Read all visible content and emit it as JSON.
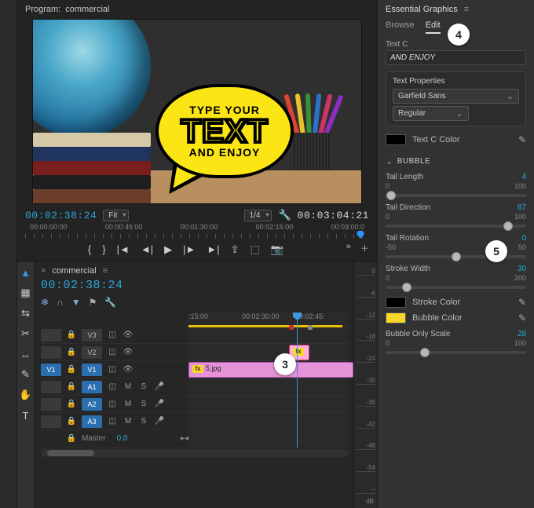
{
  "program": {
    "label": "Program:",
    "sequence_name": "commercial",
    "bubble_text": {
      "line1": "TYPE YOUR",
      "line2": "TEXT",
      "line3": "AND ENJOY"
    },
    "current_tc": "00:02:38:24",
    "fit_label": "Fit",
    "scale_label": "1/4",
    "duration_tc": "00:03:04:21",
    "ruler_labels": [
      "00:00:00:00",
      "00:00:45:00",
      "00:01:30:00",
      "00:02:15:00",
      "00:03:00:0"
    ]
  },
  "timeline": {
    "sequence_name": "commercial",
    "playhead_tc": "00:02:38:24",
    "ruler_labels": [
      ":15:00",
      "00:02:30:00",
      "00:02:45:"
    ],
    "tracks": {
      "video": [
        {
          "src": "",
          "name": "V3"
        },
        {
          "src": "",
          "name": "V2"
        },
        {
          "src": "V1",
          "name": "V1"
        }
      ],
      "audio": [
        {
          "src": "",
          "name": "A1"
        },
        {
          "src": "",
          "name": "A2"
        },
        {
          "src": "",
          "name": "A3"
        }
      ],
      "master_label": "Master",
      "master_value": "0,0"
    },
    "clips": {
      "v2_fx": "fx",
      "v1_fx": "fx",
      "v1_name": "5.jpg"
    },
    "meter_marks": [
      "0",
      "-6",
      "-12",
      "-18",
      "-24",
      "-30",
      "-36",
      "-42",
      "-48",
      "-54",
      "--"
    ],
    "meter_unit": "dB"
  },
  "tools": [
    "selection",
    "track-select",
    "ripple",
    "razor",
    "slip",
    "pen",
    "hand",
    "type"
  ],
  "eg": {
    "panel_title": "Essential Graphics",
    "tabs": {
      "browse": "Browse",
      "edit": "Edit"
    },
    "text_field_label": "Text C",
    "text_field_value": "AND ENJOY",
    "text_properties_title": "Text Properties",
    "font_family": "Garfield Sans",
    "font_style": "Regular",
    "text_color_label": "Text C Color",
    "text_color": "#000000",
    "bubble_section": "BUBBLE",
    "sliders": {
      "tail_length": {
        "label": "Tail Length",
        "value": "4",
        "min": "0",
        "max": "100",
        "pos": 4
      },
      "tail_direction": {
        "label": "Tail Direction",
        "value": "87",
        "min": "0",
        "max": "100",
        "pos": 87
      },
      "tail_rotation": {
        "label": "Tail Rotation",
        "value": "0",
        "min": "-50",
        "max": "50",
        "pos": 50
      },
      "stroke_width": {
        "label": "Stroke Width",
        "value": "30",
        "min": "0",
        "max": "200",
        "pos": 15
      },
      "bubble_scale": {
        "label": "Bubble Only Scale",
        "value": "28",
        "min": "0",
        "max": "100",
        "pos": 28
      }
    },
    "stroke_color_label": "Stroke Color",
    "stroke_color": "#000000",
    "bubble_color_label": "Bubble Color",
    "bubble_color": "#f8d929"
  },
  "callouts": {
    "c3": "3",
    "c4": "4",
    "c5": "5"
  }
}
